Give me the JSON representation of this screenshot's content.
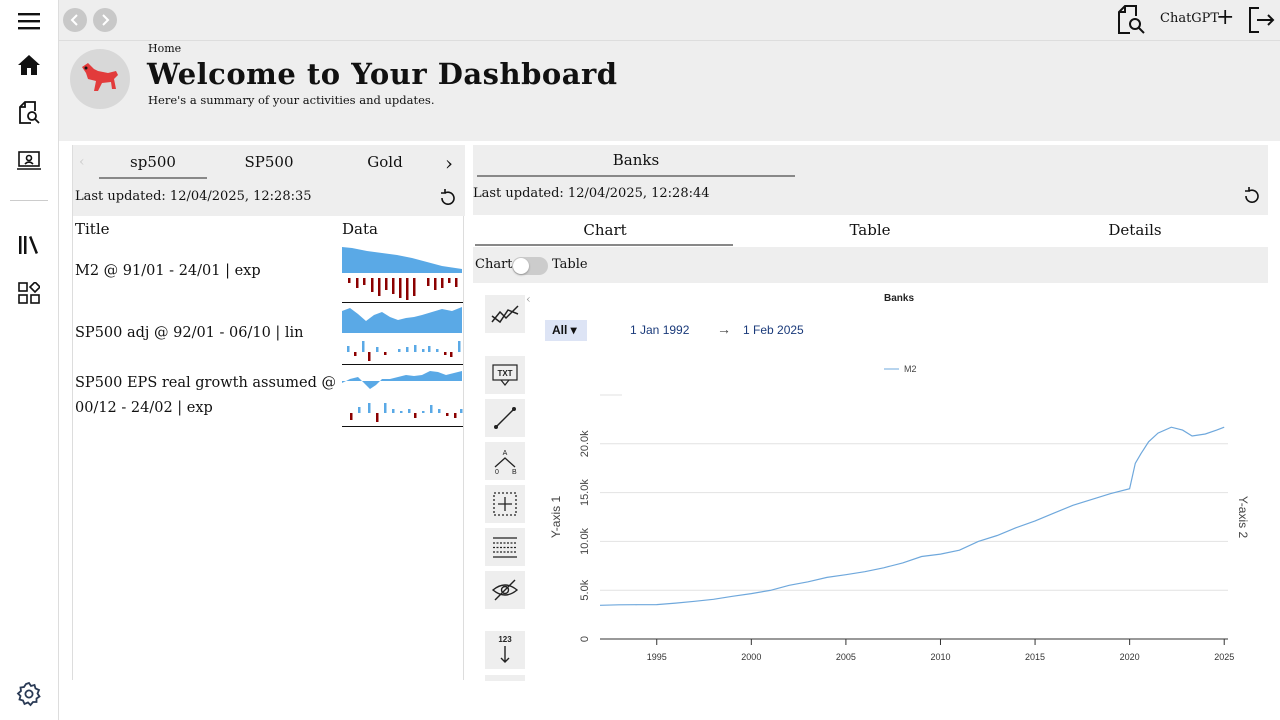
{
  "topbar": {
    "chatgpt_label": "ChatGPT",
    "plus_label": "+"
  },
  "header": {
    "breadcrumb": "Home",
    "title": "Welcome to Your Dashboard",
    "subtitle": "Here's a summary of your activities and updates."
  },
  "left_panel": {
    "tabs": [
      "sp500",
      "SP500",
      "Gold"
    ],
    "last_updated": "Last updated: 12/04/2025, 12:28:35",
    "columns": [
      "Title",
      "Data"
    ],
    "rows": [
      {
        "title": "M2 @ 91/01 - 24/01 | exp"
      },
      {
        "title": "SP500 adj @ 92/01 - 06/10 | lin"
      },
      {
        "title": "SP500 EPS real growth assumed @ 00/12 - 24/02 | exp"
      }
    ]
  },
  "right_panel": {
    "tab": "Banks",
    "last_updated": "Last updated: 12/04/2025, 12:28:44",
    "subtabs": [
      "Chart",
      "Table",
      "Details"
    ],
    "toggle_left": "Chart",
    "toggle_right": "Table",
    "range_select": "All ▾",
    "date_from": "1 Jan 1992",
    "arrow": "→",
    "date_to": "1 Feb 2025"
  },
  "colors": {
    "accent": "#5aa9e6",
    "negative": "#8b0000",
    "line": "#6fa8dc"
  },
  "chart_data": {
    "type": "line",
    "title": "Banks",
    "ylabel": "Y-axis 1",
    "ylabel2": "Y-axis 2",
    "xlim": [
      1992,
      2025.2
    ],
    "ylim": [
      0,
      25000
    ],
    "x_ticks": [
      1995,
      2000,
      2005,
      2010,
      2015,
      2020,
      2025
    ],
    "y_ticks": [
      {
        "v": 0,
        "label": "0"
      },
      {
        "v": 5000,
        "label": "5.0k"
      },
      {
        "v": 10000,
        "label": "10.0k"
      },
      {
        "v": 15000,
        "label": "15.0k"
      },
      {
        "v": 20000,
        "label": "20.0k"
      }
    ],
    "legend_position": "top-center",
    "series": [
      {
        "name": "M2",
        "x": [
          1992,
          1993,
          1994,
          1995,
          1996,
          1997,
          1998,
          1999,
          2000,
          2001,
          2002,
          2003,
          2004,
          2005,
          2006,
          2007,
          2008,
          2009,
          2010,
          2011,
          2012,
          2013,
          2014,
          2015,
          2016,
          2017,
          2018,
          2019,
          2020.0,
          2020.3,
          2020.6,
          2021,
          2021.5,
          2022.2,
          2022.8,
          2023.3,
          2024,
          2024.6,
          2025
        ],
        "y": [
          3450,
          3500,
          3510,
          3520,
          3680,
          3860,
          4070,
          4380,
          4650,
          4980,
          5500,
          5860,
          6310,
          6590,
          6900,
          7300,
          7800,
          8450,
          8700,
          9100,
          10000,
          10600,
          11400,
          12100,
          12900,
          13700,
          14300,
          14900,
          15400,
          18000,
          19000,
          20200,
          21100,
          21700,
          21400,
          20800,
          21000,
          21400,
          21700
        ]
      }
    ]
  }
}
